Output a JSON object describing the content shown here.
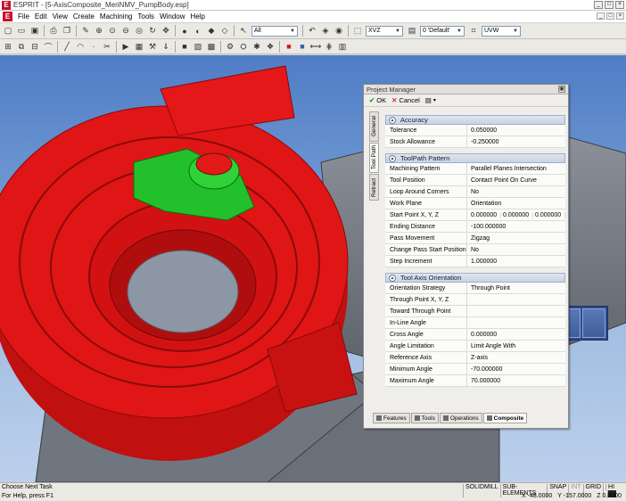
{
  "window": {
    "app_logo": "E",
    "title": "ESPRIT - [5-AxisComposite_MeriNMV_PumpBody.esp]",
    "controls": [
      "_",
      "□",
      "×"
    ]
  },
  "menubar": {
    "logo": "E",
    "items": [
      "File",
      "Edit",
      "View",
      "Create",
      "Machining",
      "Tools",
      "Window",
      "Help"
    ]
  },
  "toolbar1": {
    "layer_select": "All",
    "plane_select": "XVZ",
    "default_select": "0 'Default'",
    "uvw_select": "UVW"
  },
  "project_manager": {
    "title": "Project Manager",
    "ok_label": "OK",
    "cancel_label": "Cancel",
    "side_tabs": [
      "General",
      "Tool Path",
      "Retract"
    ],
    "sections": [
      {
        "title": "Accuracy",
        "rows": [
          {
            "label": "Tolerance",
            "value": "0.050000"
          },
          {
            "label": "Stock Allowance",
            "value": "-0.250000"
          }
        ]
      },
      {
        "title": "ToolPath Pattern",
        "rows": [
          {
            "label": "Machining Pattern",
            "value": "Parallel Planes Intersection"
          },
          {
            "label": "Tool Position",
            "value": "Contact Point On Curve"
          },
          {
            "label": "Loop Around Corners",
            "value": "No"
          },
          {
            "label": "Work Plane",
            "value": "Orientation"
          },
          {
            "label": "Start Point X, Y, Z",
            "values": [
              "0.000000",
              "0.000000",
              "0.000000"
            ]
          },
          {
            "label": "Ending Distance",
            "value": "-100.000000"
          },
          {
            "label": "Pass Movement",
            "value": "Zigzag"
          },
          {
            "label": "Change Pass Start Position",
            "value": "No"
          },
          {
            "label": "Step Increment",
            "value": "1.000000"
          }
        ]
      },
      {
        "title": "Tool Axis Orientation",
        "rows": [
          {
            "label": "Orientation Strategy",
            "value": "Through Point"
          },
          {
            "label": "Through Point X, Y, Z",
            "value": ""
          },
          {
            "label": "Toward Through Point",
            "value": ""
          },
          {
            "label": "In-Line Angle",
            "value": ""
          },
          {
            "label": "Cross Angle",
            "value": "0.000000"
          },
          {
            "label": "Angle Limitation",
            "value": "Limit Angle With"
          },
          {
            "label": "Reference Axis",
            "value": "Z-axis"
          },
          {
            "label": "Minimum Angle",
            "value": "-70.000000"
          },
          {
            "label": "Maximum Angle",
            "value": "70.000000"
          }
        ]
      }
    ],
    "bottom_tabs": [
      "Features",
      "Tools",
      "Operations",
      "Composite"
    ]
  },
  "statusbar": {
    "line1": "Choose Next Task",
    "line2": "For Help, press F1",
    "indicators": [
      "SOLIDMILL",
      "SUB-ELEMENTS",
      "SNAP",
      "INT",
      "GRID",
      "HI"
    ],
    "x": "X -48.0000",
    "y": "Y -157.0000",
    "z": "Z 0.0000"
  },
  "colors": {
    "part": "#e01515",
    "highlight": "#22c02a",
    "viewport_top": "#4f7dc6",
    "viewport_bottom": "#bcd0ec"
  }
}
